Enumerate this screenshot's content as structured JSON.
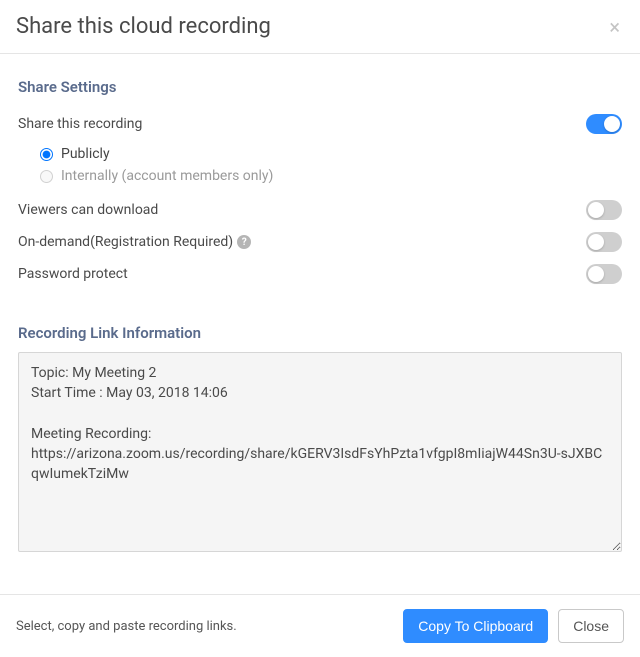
{
  "header": {
    "title": "Share this cloud recording",
    "close_icon": "×"
  },
  "settings": {
    "section_title": "Share Settings",
    "share": {
      "label": "Share this recording",
      "on": true,
      "options": {
        "public": {
          "label": "Publicly",
          "selected": true,
          "disabled": false
        },
        "internal": {
          "label": "Internally (account members only)",
          "selected": false,
          "disabled": true
        }
      }
    },
    "download": {
      "label": "Viewers can download",
      "on": false
    },
    "ondemand": {
      "label": "On-demand(Registration Required)",
      "help": "?",
      "on": false
    },
    "password": {
      "label": "Password protect",
      "on": false
    }
  },
  "link_info": {
    "section_title": "Recording Link Information",
    "text": "Topic: My Meeting 2\nStart Time : May 03, 2018 14:06\n\nMeeting Recording:\nhttps://arizona.zoom.us/recording/share/kGERV3IsdFsYhPzta1vfgpI8mIiajW44Sn3U-sJXBCqwIumekTziMw"
  },
  "footer": {
    "hint": "Select, copy and paste recording links.",
    "copy_label": "Copy To Clipboard",
    "close_label": "Close"
  }
}
